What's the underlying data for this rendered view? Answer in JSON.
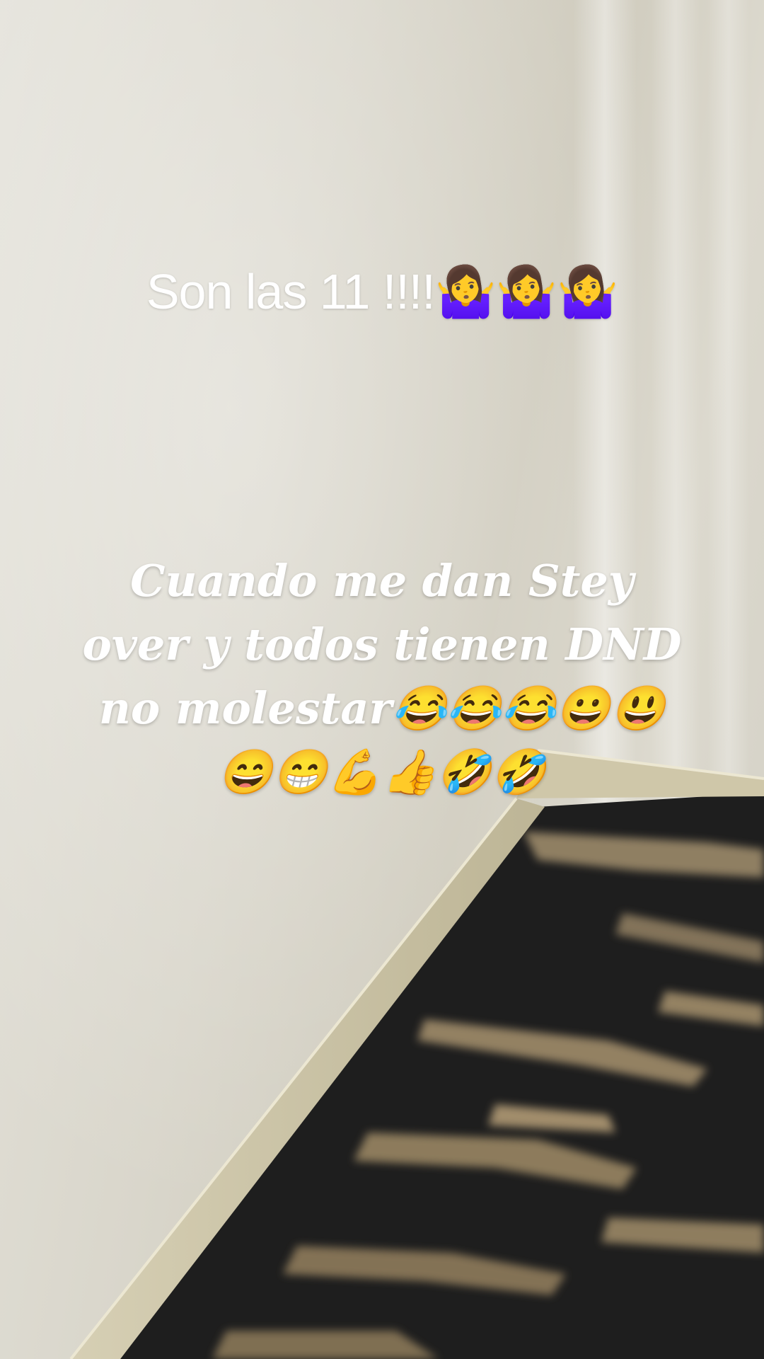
{
  "overlay": {
    "top_caption": "Son las 11 !!!!🤷‍♀️🤷‍♀️🤷‍♀️",
    "main_caption_lines": [
      "Cuando me dan Stey",
      "over y todos tienen DND",
      "no molestar😂😂😂😀😃",
      "😄😁💪👍🤣🤣"
    ]
  },
  "colors": {
    "caption_text": "#ffffff",
    "wall": "#d9d6cb",
    "baseboard": "#c9c2a6",
    "carpet_dark": "#1c1c1c",
    "carpet_tan": "#9c8a6a"
  }
}
